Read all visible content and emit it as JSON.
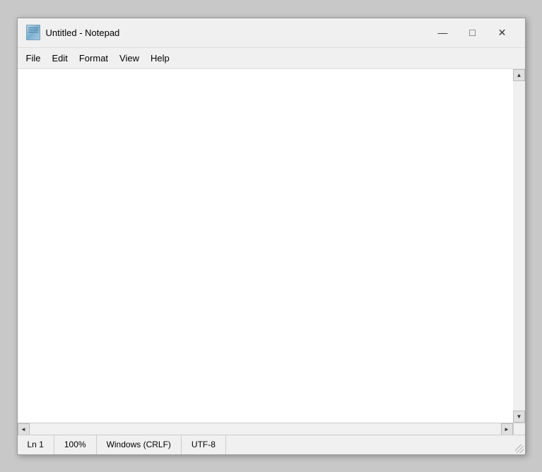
{
  "window": {
    "title": "Untitled - Notepad",
    "icon_label": "notepad-icon"
  },
  "title_controls": {
    "minimize": "—",
    "maximize": "□",
    "close": "✕"
  },
  "menu": {
    "items": [
      "File",
      "Edit",
      "Format",
      "View",
      "Help"
    ]
  },
  "editor": {
    "content": "",
    "placeholder": ""
  },
  "scrollbars": {
    "up_arrow": "▲",
    "down_arrow": "▼",
    "left_arrow": "◄",
    "right_arrow": "►"
  },
  "status_bar": {
    "line": "Ln 1",
    "zoom": "100%",
    "line_ending": "Windows (CRLF)",
    "encoding": "UTF-8"
  }
}
